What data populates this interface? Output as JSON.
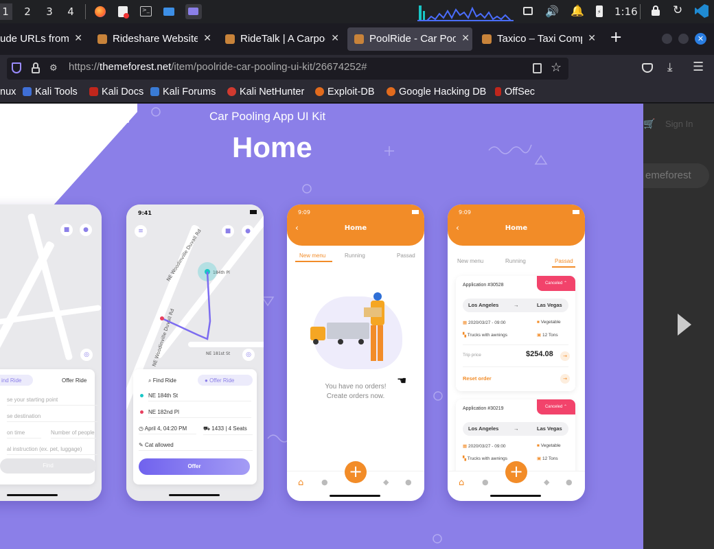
{
  "taskbar": {
    "workspaces": [
      "1",
      "2",
      "3",
      "4"
    ],
    "time": "1:16"
  },
  "tabs": [
    {
      "title": "ude URLs from o"
    },
    {
      "title": "Rideshare Website T"
    },
    {
      "title": "RideTalk | A Carpool"
    },
    {
      "title": "PoolRide - Car Pooli"
    },
    {
      "title": "Taxico – Taxi Compa"
    }
  ],
  "url": {
    "prefix": "https://",
    "host": "themeforest.net",
    "path": "/item/poolride-car-pooling-ui-kit/26674252#"
  },
  "bookmarks": [
    "nux",
    "Kali Tools",
    "Kali Docs",
    "Kali Forums",
    "Kali NetHunter",
    "Exploit-DB",
    "Google Hacking DB",
    "OffSec"
  ],
  "colors": {
    "accent": "#8b7fe8",
    "orange": "#f28c28",
    "red": "#f2436b"
  },
  "page": {
    "subtitle": "Car Pooling App UI Kit",
    "title": "Home",
    "sign_in": "Sign In",
    "brand": "emeforest",
    "phone1": {
      "find_ride": "ind Ride",
      "offer_ride": "Offer Ride",
      "f1": "se your starting point",
      "f2": "se destination",
      "f3": "on time",
      "f4": "Number of people",
      "f5": "al instruction (ex. pet, luggage)",
      "button": "Find"
    },
    "phone2": {
      "time": "9:41",
      "find_ride": "Find Ride",
      "offer_ride": "Offer Ride",
      "from": "NE 184th St",
      "to": "NE 182nd Pl",
      "date": "April 4, 04:20 PM",
      "seats": "1433 | 4 Seats",
      "note": "Cat allowed",
      "button": "Offer",
      "streets": [
        "NE Woodinville Duvall Rd",
        "NE Woodinville Duvall Rd",
        "184th Pl",
        "NE 181st St",
        "Woodin"
      ]
    },
    "phone3": {
      "time": "9:09",
      "title": "Home",
      "tabs": [
        "New menu",
        "Running",
        "Passad"
      ],
      "empty1": "You have no orders!",
      "empty2": "Create orders now."
    },
    "phone4": {
      "time": "9:09",
      "title": "Home",
      "tabs": [
        "New menu",
        "Running",
        "Passad"
      ],
      "apps": [
        {
          "id": "Application #30528",
          "status": "Canceled",
          "from": "Los Angeles",
          "to": "Las Vegas",
          "date": "2020/03/27 - 09:00",
          "cargo": "Vegetable",
          "truck": "Trucks with awnings",
          "weight": "12 Tons",
          "price_label": "Trip price",
          "price": "$254.08",
          "reset": "Reset order"
        },
        {
          "id": "Application #30219",
          "status": "Canceled",
          "from": "Los Angeles",
          "to": "Las Vegas",
          "date": "2020/03/27 - 09:00",
          "cargo": "Vegetable",
          "truck": "Trucks with awnings",
          "weight": "12 Tons"
        }
      ]
    }
  }
}
